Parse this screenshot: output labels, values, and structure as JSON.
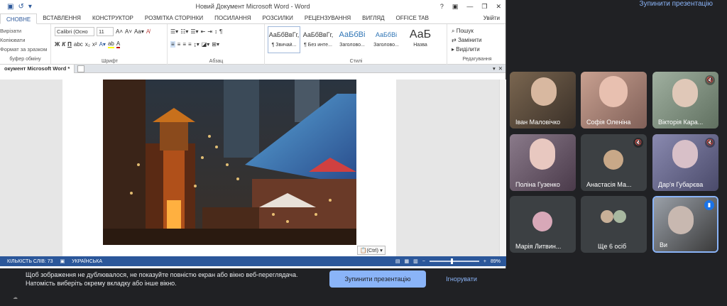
{
  "word": {
    "title": "Новий Документ Microsoft Word - Word",
    "tabs": [
      "СНОВНЕ",
      "ВСТАВЛЕННЯ",
      "КОНСТРУКТОР",
      "РОЗМІТКА СТОРІНКИ",
      "ПОСИЛАННЯ",
      "РОЗСИЛКИ",
      "РЕЦЕНЗУВАННЯ",
      "ВИГЛЯД",
      "OFFICE TAB"
    ],
    "user": "Увійти",
    "clipboard": {
      "cut": "Вирізати",
      "copy": "Копіювати",
      "format": "Формат за зразком",
      "label": "буфер обміну"
    },
    "font": {
      "name": "Calibri (Осно",
      "size": "11",
      "label": "Шрифт"
    },
    "paragraph_label": "Абзац",
    "styles": [
      {
        "sample": "АаБбВвГг,",
        "name": "¶ Звичай..."
      },
      {
        "sample": "АаБбВвГг,",
        "name": "¶ Без инте..."
      },
      {
        "sample": "АаБбВі",
        "name": "Заголово..."
      },
      {
        "sample": "АаБбВі",
        "name": "Заголово..."
      },
      {
        "sample": "АаБ",
        "name": "Назва"
      }
    ],
    "styles_label": "Стилі",
    "edit": {
      "find": "Пошук",
      "replace": "Замінити",
      "select": "Виділити",
      "label": "Редагування"
    },
    "doc_tab": "окумент Microsoft Word *",
    "paste": "(Ctrl)",
    "status": {
      "words": "КІЛЬКІСТЬ СЛІВ: 73",
      "lang": "УКРАЇНСЬКА",
      "zoom": "89%"
    }
  },
  "meet": {
    "stop_top": "Зупинити презентацію",
    "participants": [
      {
        "name": "Іван Маловічко",
        "muted": false,
        "color": "#6b5a4a"
      },
      {
        "name": "Софія Оленіна",
        "muted": false,
        "color": "#b38a7a"
      },
      {
        "name": "Вікторія Кара...",
        "muted": true,
        "color": "#8a9a8a"
      },
      {
        "name": "Поліна Гузенко",
        "muted": false,
        "color": "#7a6a7a"
      },
      {
        "name": "Анастасія Ма...",
        "muted": true,
        "color": "#3c4043"
      },
      {
        "name": "Дар'я Губарєва",
        "muted": true,
        "color": "#6a6a8a"
      },
      {
        "name": "Марія Литвин...",
        "muted": false,
        "color": "#3c4043"
      },
      {
        "name": "Ще 6 осіб",
        "muted": false,
        "color": "#3c4043"
      },
      {
        "name": "Ви",
        "muted": false,
        "color": "#5a5a5a"
      }
    ],
    "warning": "Щоб зображення не дублювалося, не показуйте повністю екран або вікно веб-переглядача. Натомість виберіть окрему вкладку або інше вікно.",
    "stop_button": "Зупинити презентацію",
    "ignore_button": "Ігнорувати"
  }
}
